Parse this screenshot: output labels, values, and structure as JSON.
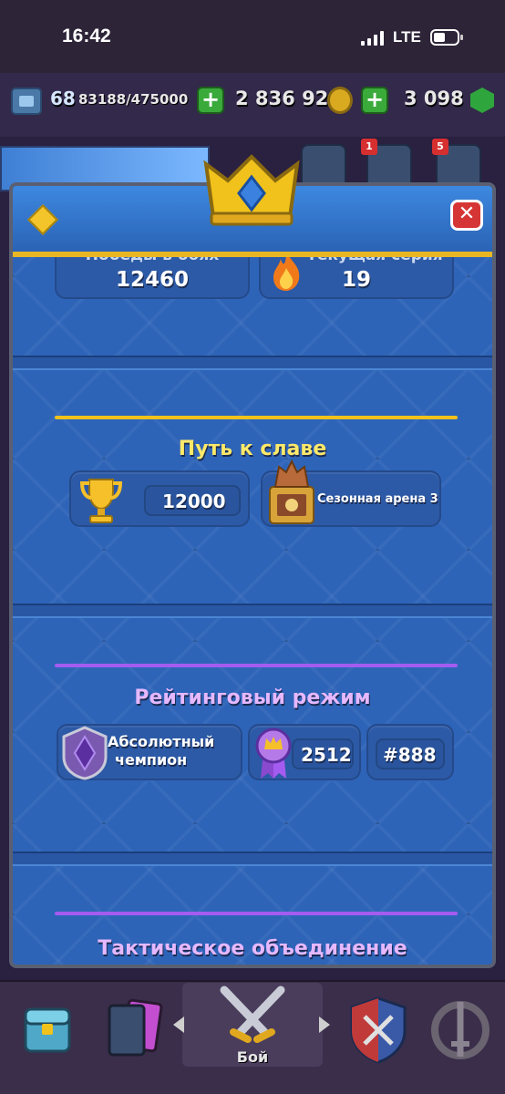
{
  "status_bar": {
    "time": "16:42",
    "network": "LTE"
  },
  "resources": {
    "level": "68",
    "xp": "83188/475000",
    "gold": "2 836 921",
    "gems": "3 098"
  },
  "notifications": {
    "badge_1": "1",
    "badge_2": "5"
  },
  "stats": {
    "wins_label": "Победы в боях",
    "wins_value": "12460",
    "streak_label": "Текущая серия",
    "streak_value": "19"
  },
  "path_of_legends": {
    "title": "Путь к славе",
    "trophies": "12000",
    "arena": "Сезонная арена 3"
  },
  "ranked": {
    "title": "Рейтинговый режим",
    "league_line1": "Абсолютный",
    "league_line2": "чемпион",
    "rating": "2512",
    "rank": "#888"
  },
  "tactical": {
    "title": "Тактическое объединение"
  },
  "bottom_nav": {
    "active_label": "Бой"
  },
  "colors": {
    "gold_rule": "#f1c21b",
    "purple_rule": "#a45cf0",
    "purple_title": "#e5b8ff",
    "gold_title": "#ffe96a"
  }
}
